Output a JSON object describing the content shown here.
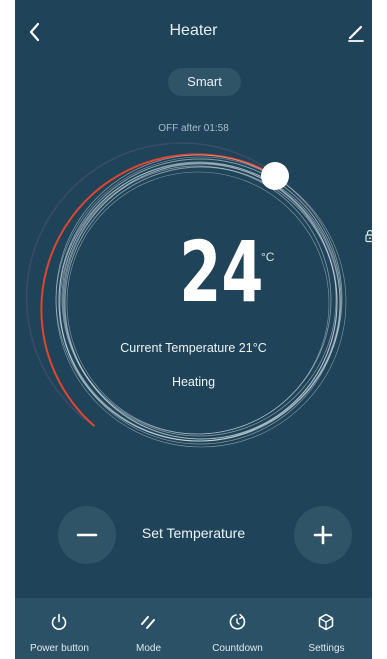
{
  "header": {
    "title": "Heater",
    "back_icon": "chevron-left-icon",
    "edit_icon": "pencil-icon"
  },
  "mode_chip": "Smart",
  "timer_status": "OFF after 01:58",
  "dial": {
    "set_temperature": "24",
    "unit": "°C",
    "current_temperature": "Current Temperature 21°C",
    "status": "Heating",
    "lock_icon": "lock-icon",
    "arc_color_heat": "#e0452f",
    "arc_color_rest": "#3d4a6b",
    "ring_color": "#d9e4ea"
  },
  "controls": {
    "set_label": "Set Temperature",
    "minus_icon": "minus-icon",
    "plus_icon": "plus-icon"
  },
  "bottom_bar": [
    {
      "label": "Power button",
      "icon": "power-icon"
    },
    {
      "label": "Mode",
      "icon": "mode-icon"
    },
    {
      "label": "Countdown",
      "icon": "countdown-icon"
    },
    {
      "label": "Settings",
      "icon": "settings-icon"
    }
  ],
  "colors": {
    "background": "#1f4358",
    "chip": "#2f5468",
    "bottom_bar": "#2a5166"
  }
}
